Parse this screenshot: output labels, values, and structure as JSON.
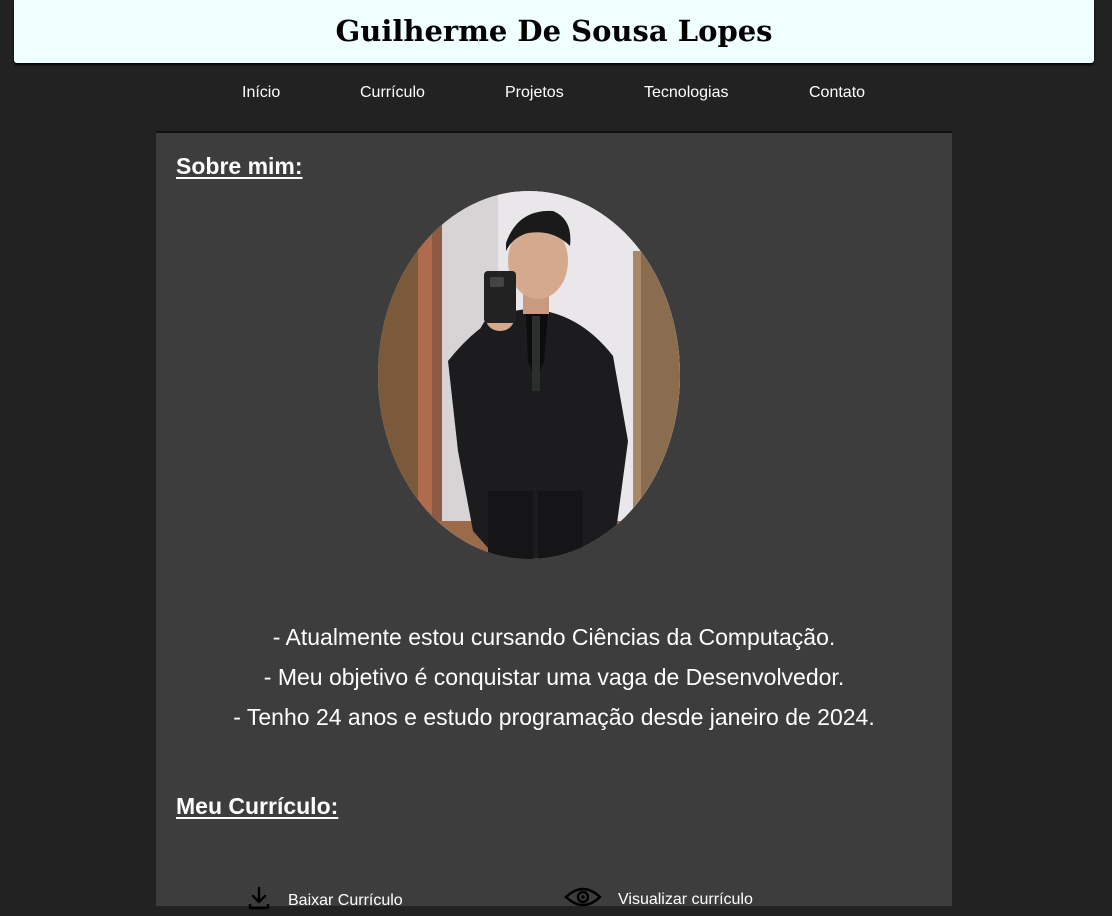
{
  "header": {
    "title": "Guilherme De Sousa Lopes"
  },
  "nav": {
    "items": [
      {
        "label": "Início"
      },
      {
        "label": "Currículo"
      },
      {
        "label": "Projetos"
      },
      {
        "label": "Tecnologias"
      },
      {
        "label": "Contato"
      }
    ]
  },
  "about": {
    "heading": "Sobre mim:",
    "photo_icon": "portrait-photo",
    "lines": [
      "- Atualmente estou cursando Ciências da Computação.",
      "- Meu objetivo é conquistar uma vaga de Desenvolvedor.",
      "- Tenho 24 anos e estudo programação desde janeiro de 2024."
    ]
  },
  "resume": {
    "heading": "Meu Currículo:",
    "download_label": "Baixar Currículo",
    "download_icon": "download-icon",
    "view_label": "Visualizar currículo",
    "view_icon": "eye-icon"
  },
  "colors": {
    "page_background": "#222222",
    "header_background": "#f0ffff",
    "content_background": "#3d3d3d",
    "text": "#ffffff"
  }
}
